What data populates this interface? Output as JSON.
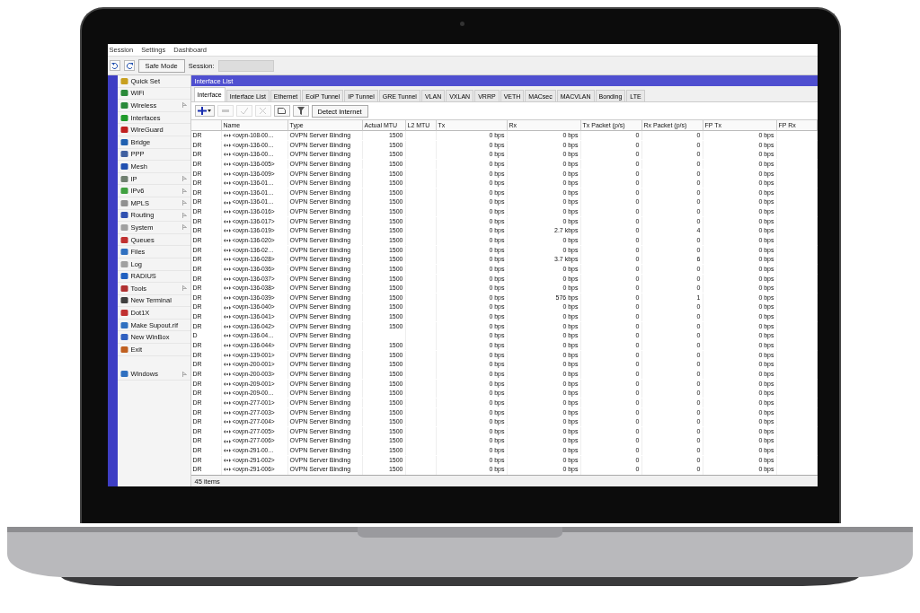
{
  "menu_bar": [
    "Session",
    "Settings",
    "Dashboard"
  ],
  "toolbar": {
    "safe_mode": "Safe Mode",
    "session_label": "Session:"
  },
  "sidebar": {
    "items": [
      {
        "label": "Quick Set",
        "has_submenu": false
      },
      {
        "label": "WiFi",
        "has_submenu": false
      },
      {
        "label": "Wireless",
        "has_submenu": true
      },
      {
        "label": "Interfaces",
        "has_submenu": false
      },
      {
        "label": "WireGuard",
        "has_submenu": false
      },
      {
        "label": "Bridge",
        "has_submenu": false
      },
      {
        "label": "PPP",
        "has_submenu": false
      },
      {
        "label": "Mesh",
        "has_submenu": false
      },
      {
        "label": "IP",
        "has_submenu": true
      },
      {
        "label": "IPv6",
        "has_submenu": true
      },
      {
        "label": "MPLS",
        "has_submenu": true
      },
      {
        "label": "Routing",
        "has_submenu": true
      },
      {
        "label": "System",
        "has_submenu": true
      },
      {
        "label": "Queues",
        "has_submenu": false
      },
      {
        "label": "Files",
        "has_submenu": false
      },
      {
        "label": "Log",
        "has_submenu": false
      },
      {
        "label": "RADIUS",
        "has_submenu": false
      },
      {
        "label": "Tools",
        "has_submenu": true
      },
      {
        "label": "New Terminal",
        "has_submenu": false
      },
      {
        "label": "Dot1X",
        "has_submenu": false
      },
      {
        "label": "Make Supout.rif",
        "has_submenu": false
      },
      {
        "label": "New WinBox",
        "has_submenu": false
      },
      {
        "label": "Exit",
        "has_submenu": false
      }
    ],
    "bottom_items": [
      {
        "label": "Windows",
        "has_submenu": true
      }
    ]
  },
  "window": {
    "title": "Interface List",
    "tabs": [
      {
        "label": "Interface",
        "selected": true
      },
      {
        "label": "Interface List",
        "selected": false
      },
      {
        "label": "Ethernet",
        "selected": false
      },
      {
        "label": "EoIP Tunnel",
        "selected": false
      },
      {
        "label": "IP Tunnel",
        "selected": false
      },
      {
        "label": "GRE Tunnel",
        "selected": false
      },
      {
        "label": "VLAN",
        "selected": false
      },
      {
        "label": "VXLAN",
        "selected": false
      },
      {
        "label": "VRRP",
        "selected": false
      },
      {
        "label": "VETH",
        "selected": false
      },
      {
        "label": "MACsec",
        "selected": false
      },
      {
        "label": "MACVLAN",
        "selected": false
      },
      {
        "label": "Bonding",
        "selected": false
      },
      {
        "label": "LTE",
        "selected": false
      }
    ],
    "tools": [
      {
        "kind": "add",
        "disabled": false
      },
      {
        "kind": "remove",
        "disabled": true
      },
      {
        "kind": "enable",
        "disabled": true
      },
      {
        "kind": "disable",
        "disabled": true
      },
      {
        "kind": "comment",
        "disabled": false
      },
      {
        "kind": "filter",
        "disabled": false
      }
    ],
    "detect_button": "Detect Internet",
    "table": {
      "columns": [
        "",
        "Name",
        "Type",
        "Actual MTU",
        "L2 MTU",
        "Tx",
        "Rx",
        "Tx Packet (p/s)",
        "Rx Packet (p/s)",
        "FP Tx",
        "FP Rx"
      ],
      "rows": [
        [
          "DR",
          "<ovpn-108-00…",
          "OVPN Server Binding",
          "1500",
          "0 bps",
          "0 bps",
          "0",
          "0",
          "0 bps"
        ],
        [
          "DR",
          "<ovpn-136-00…",
          "OVPN Server Binding",
          "1500",
          "0 bps",
          "0 bps",
          "0",
          "0",
          "0 bps"
        ],
        [
          "DR",
          "<ovpn-136-00…",
          "OVPN Server Binding",
          "1500",
          "0 bps",
          "0 bps",
          "0",
          "0",
          "0 bps"
        ],
        [
          "DR",
          "<ovpn-136-005>",
          "OVPN Server Binding",
          "1500",
          "0 bps",
          "0 bps",
          "0",
          "0",
          "0 bps"
        ],
        [
          "DR",
          "<ovpn-136-009>",
          "OVPN Server Binding",
          "1500",
          "0 bps",
          "0 bps",
          "0",
          "0",
          "0 bps"
        ],
        [
          "DR",
          "<ovpn-136-01…",
          "OVPN Server Binding",
          "1500",
          "0 bps",
          "0 bps",
          "0",
          "0",
          "0 bps"
        ],
        [
          "DR",
          "<ovpn-136-01…",
          "OVPN Server Binding",
          "1500",
          "0 bps",
          "0 bps",
          "0",
          "0",
          "0 bps"
        ],
        [
          "DR",
          "<ovpn-136-01…",
          "OVPN Server Binding",
          "1500",
          "0 bps",
          "0 bps",
          "0",
          "0",
          "0 bps"
        ],
        [
          "DR",
          "<ovpn-136-016>",
          "OVPN Server Binding",
          "1500",
          "0 bps",
          "0 bps",
          "0",
          "0",
          "0 bps"
        ],
        [
          "DR",
          "<ovpn-136-017>",
          "OVPN Server Binding",
          "1500",
          "0 bps",
          "0 bps",
          "0",
          "0",
          "0 bps"
        ],
        [
          "DR",
          "<ovpn-136-019>",
          "OVPN Server Binding",
          "1500",
          "0 bps",
          "2.7 kbps",
          "0",
          "4",
          "0 bps"
        ],
        [
          "DR",
          "<ovpn-136-020>",
          "OVPN Server Binding",
          "1500",
          "0 bps",
          "0 bps",
          "0",
          "0",
          "0 bps"
        ],
        [
          "DR",
          "<ovpn-136-02…",
          "OVPN Server Binding",
          "1500",
          "0 bps",
          "0 bps",
          "0",
          "0",
          "0 bps"
        ],
        [
          "DR",
          "<ovpn-136-028>",
          "OVPN Server Binding",
          "1500",
          "0 bps",
          "3.7 kbps",
          "0",
          "6",
          "0 bps"
        ],
        [
          "DR",
          "<ovpn-136-036>",
          "OVPN Server Binding",
          "1500",
          "0 bps",
          "0 bps",
          "0",
          "0",
          "0 bps"
        ],
        [
          "DR",
          "<ovpn-136-037>",
          "OVPN Server Binding",
          "1500",
          "0 bps",
          "0 bps",
          "0",
          "0",
          "0 bps"
        ],
        [
          "DR",
          "<ovpn-136-038>",
          "OVPN Server Binding",
          "1500",
          "0 bps",
          "0 bps",
          "0",
          "0",
          "0 bps"
        ],
        [
          "DR",
          "<ovpn-136-039>",
          "OVPN Server Binding",
          "1500",
          "0 bps",
          "576 bps",
          "0",
          "1",
          "0 bps"
        ],
        [
          "DR",
          "<ovpn-136-040>",
          "OVPN Server Binding",
          "1500",
          "0 bps",
          "0 bps",
          "0",
          "0",
          "0 bps"
        ],
        [
          "DR",
          "<ovpn-136-041>",
          "OVPN Server Binding",
          "1500",
          "0 bps",
          "0 bps",
          "0",
          "0",
          "0 bps"
        ],
        [
          "DR",
          "<ovpn-136-042>",
          "OVPN Server Binding",
          "1500",
          "0 bps",
          "0 bps",
          "0",
          "0",
          "0 bps"
        ],
        [
          "D",
          "<ovpn-136-04…",
          "OVPN Server Binding",
          "",
          "0 bps",
          "0 bps",
          "0",
          "0",
          "0 bps"
        ],
        [
          "DR",
          "<ovpn-136-044>",
          "OVPN Server Binding",
          "1500",
          "0 bps",
          "0 bps",
          "0",
          "0",
          "0 bps"
        ],
        [
          "DR",
          "<ovpn-139-001>",
          "OVPN Server Binding",
          "1500",
          "0 bps",
          "0 bps",
          "0",
          "0",
          "0 bps"
        ],
        [
          "DR",
          "<ovpn-200-001>",
          "OVPN Server Binding",
          "1500",
          "0 bps",
          "0 bps",
          "0",
          "0",
          "0 bps"
        ],
        [
          "DR",
          "<ovpn-200-003>",
          "OVPN Server Binding",
          "1500",
          "0 bps",
          "0 bps",
          "0",
          "0",
          "0 bps"
        ],
        [
          "DR",
          "<ovpn-209-001>",
          "OVPN Server Binding",
          "1500",
          "0 bps",
          "0 bps",
          "0",
          "0",
          "0 bps"
        ],
        [
          "DR",
          "<ovpn-209-00…",
          "OVPN Server Binding",
          "1500",
          "0 bps",
          "0 bps",
          "0",
          "0",
          "0 bps"
        ],
        [
          "DR",
          "<ovpn-277-001>",
          "OVPN Server Binding",
          "1500",
          "0 bps",
          "0 bps",
          "0",
          "0",
          "0 bps"
        ],
        [
          "DR",
          "<ovpn-277-003>",
          "OVPN Server Binding",
          "1500",
          "0 bps",
          "0 bps",
          "0",
          "0",
          "0 bps"
        ],
        [
          "DR",
          "<ovpn-277-004>",
          "OVPN Server Binding",
          "1500",
          "0 bps",
          "0 bps",
          "0",
          "0",
          "0 bps"
        ],
        [
          "DR",
          "<ovpn-277-005>",
          "OVPN Server Binding",
          "1500",
          "0 bps",
          "0 bps",
          "0",
          "0",
          "0 bps"
        ],
        [
          "DR",
          "<ovpn-277-006>",
          "OVPN Server Binding",
          "1500",
          "0 bps",
          "0 bps",
          "0",
          "0",
          "0 bps"
        ],
        [
          "DR",
          "<ovpn-291-00…",
          "OVPN Server Binding",
          "1500",
          "0 bps",
          "0 bps",
          "0",
          "0",
          "0 bps"
        ],
        [
          "DR",
          "<ovpn-291-002>",
          "OVPN Server Binding",
          "1500",
          "0 bps",
          "0 bps",
          "0",
          "0",
          "0 bps"
        ],
        [
          "DR",
          "<ovpn-291-006>",
          "OVPN Server Binding",
          "1500",
          "0 bps",
          "0 bps",
          "0",
          "0",
          "0 bps"
        ]
      ]
    },
    "status": "45 items"
  }
}
